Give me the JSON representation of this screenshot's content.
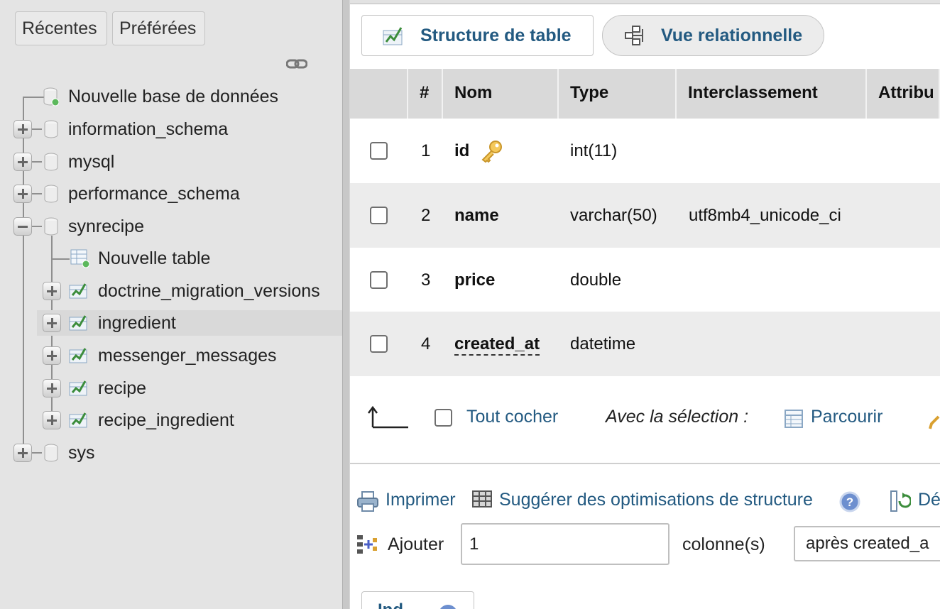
{
  "sidebar": {
    "tabs": {
      "recent": "Récentes",
      "favorites": "Préférées"
    },
    "tree": {
      "new_db": "Nouvelle base de données",
      "databases": [
        {
          "name": "information_schema"
        },
        {
          "name": "mysql"
        },
        {
          "name": "performance_schema"
        },
        {
          "name": "synrecipe"
        },
        {
          "name": "sys"
        }
      ],
      "new_table": "Nouvelle table",
      "tables": [
        {
          "name": "doctrine_migration_versions"
        },
        {
          "name": "ingredient",
          "selected": true
        },
        {
          "name": "messenger_messages"
        },
        {
          "name": "recipe"
        },
        {
          "name": "recipe_ingredient"
        }
      ]
    }
  },
  "main": {
    "buttons": {
      "structure": "Structure de table",
      "relational": "Vue relationnelle"
    },
    "columns_header": [
      "#",
      "Nom",
      "Type",
      "Interclassement",
      "Attribu"
    ],
    "rows": [
      {
        "num": "1",
        "name": "id",
        "type": "int(11)",
        "collation": "",
        "primary": true
      },
      {
        "num": "2",
        "name": "name",
        "type": "varchar(50)",
        "collation": "utf8mb4_unicode_ci"
      },
      {
        "num": "3",
        "name": "price",
        "type": "double",
        "collation": ""
      },
      {
        "num": "4",
        "name": "created_at",
        "type": "datetime",
        "collation": ""
      }
    ],
    "with_selection": {
      "check_all": "Tout cocher",
      "label": "Avec la sélection :",
      "browse": "Parcourir"
    },
    "footer_links": {
      "print": "Imprimer",
      "suggest": "Suggérer des optimisations de structure",
      "move": "Dé"
    },
    "add_column": {
      "label": "Ajouter",
      "count_value": "1",
      "unit": "colonne(s)",
      "position_value": "après created_a"
    },
    "bottom_partial": "Ind"
  },
  "colors": {
    "link": "#235a81",
    "sidebar_bg": "#e4e4e4",
    "header_bg": "#d9d9d9"
  }
}
